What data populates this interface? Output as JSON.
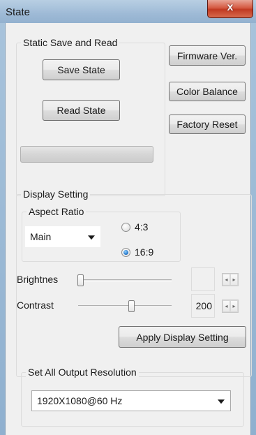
{
  "window": {
    "title": "State",
    "close_glyph": "x"
  },
  "static_group": {
    "label": "Static Save and Read",
    "save_label": "Save State",
    "read_label": "Read State",
    "progress": 0
  },
  "right_buttons": {
    "firmware": "Firmware Ver.",
    "color_balance": "Color Balance",
    "factory_reset": "Factory Reset"
  },
  "display_group": {
    "label": "Display Setting",
    "aspect_group": {
      "label": "Aspect Ratio",
      "selected": "Main",
      "options": [
        {
          "label": "4:3",
          "checked": false
        },
        {
          "label": "16:9",
          "checked": true
        }
      ]
    },
    "brightness": {
      "label": "Brightnes",
      "value": "",
      "level": 0.0
    },
    "contrast": {
      "label": "Contrast",
      "value": "200",
      "level": 0.55
    },
    "apply_label": "Apply Display Setting"
  },
  "resolution_group": {
    "label": "Set All Output Resolution",
    "selected": "1920X1080@60 Hz"
  },
  "icons": {
    "spin_left": "◂",
    "spin_right": "▸"
  }
}
